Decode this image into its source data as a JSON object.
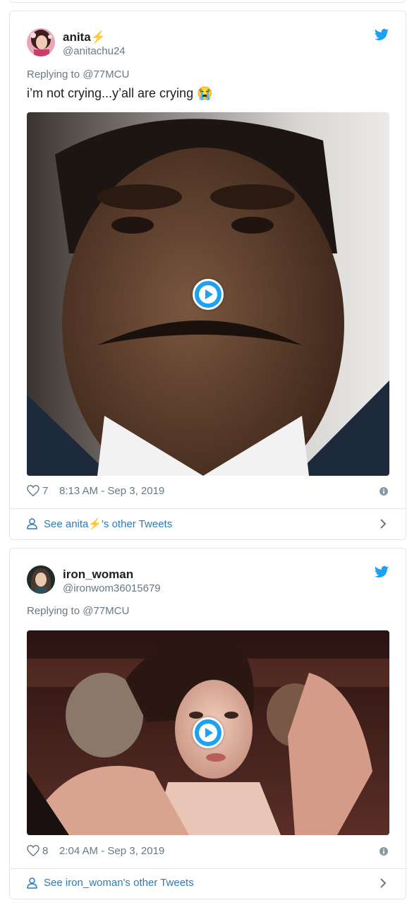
{
  "tweets": [
    {
      "display_name": "anita⚡",
      "handle": "@anitachu24",
      "reply_to": "Replying to @77MCU",
      "text": "i’m not crying...y’all are crying 😭",
      "likes": "7",
      "timestamp": "8:13 AM - Sep 3, 2019",
      "see_more": "See anita⚡'s other Tweets",
      "media": "video"
    },
    {
      "display_name": "iron_woman",
      "handle": "@ironwom36015679",
      "reply_to": "Replying to @77MCU",
      "likes": "8",
      "timestamp": "2:04 AM - Sep 3, 2019",
      "see_more": "See iron_woman's other Tweets",
      "media": "video"
    }
  ],
  "colors": {
    "accent": "#1da1f2",
    "link": "#2b7bb9",
    "muted": "#697882",
    "border": "#e1e8ed"
  },
  "icons": [
    "twitter-bird-icon",
    "play-icon",
    "heart-icon",
    "info-icon",
    "person-icon",
    "chevron-right-icon"
  ]
}
